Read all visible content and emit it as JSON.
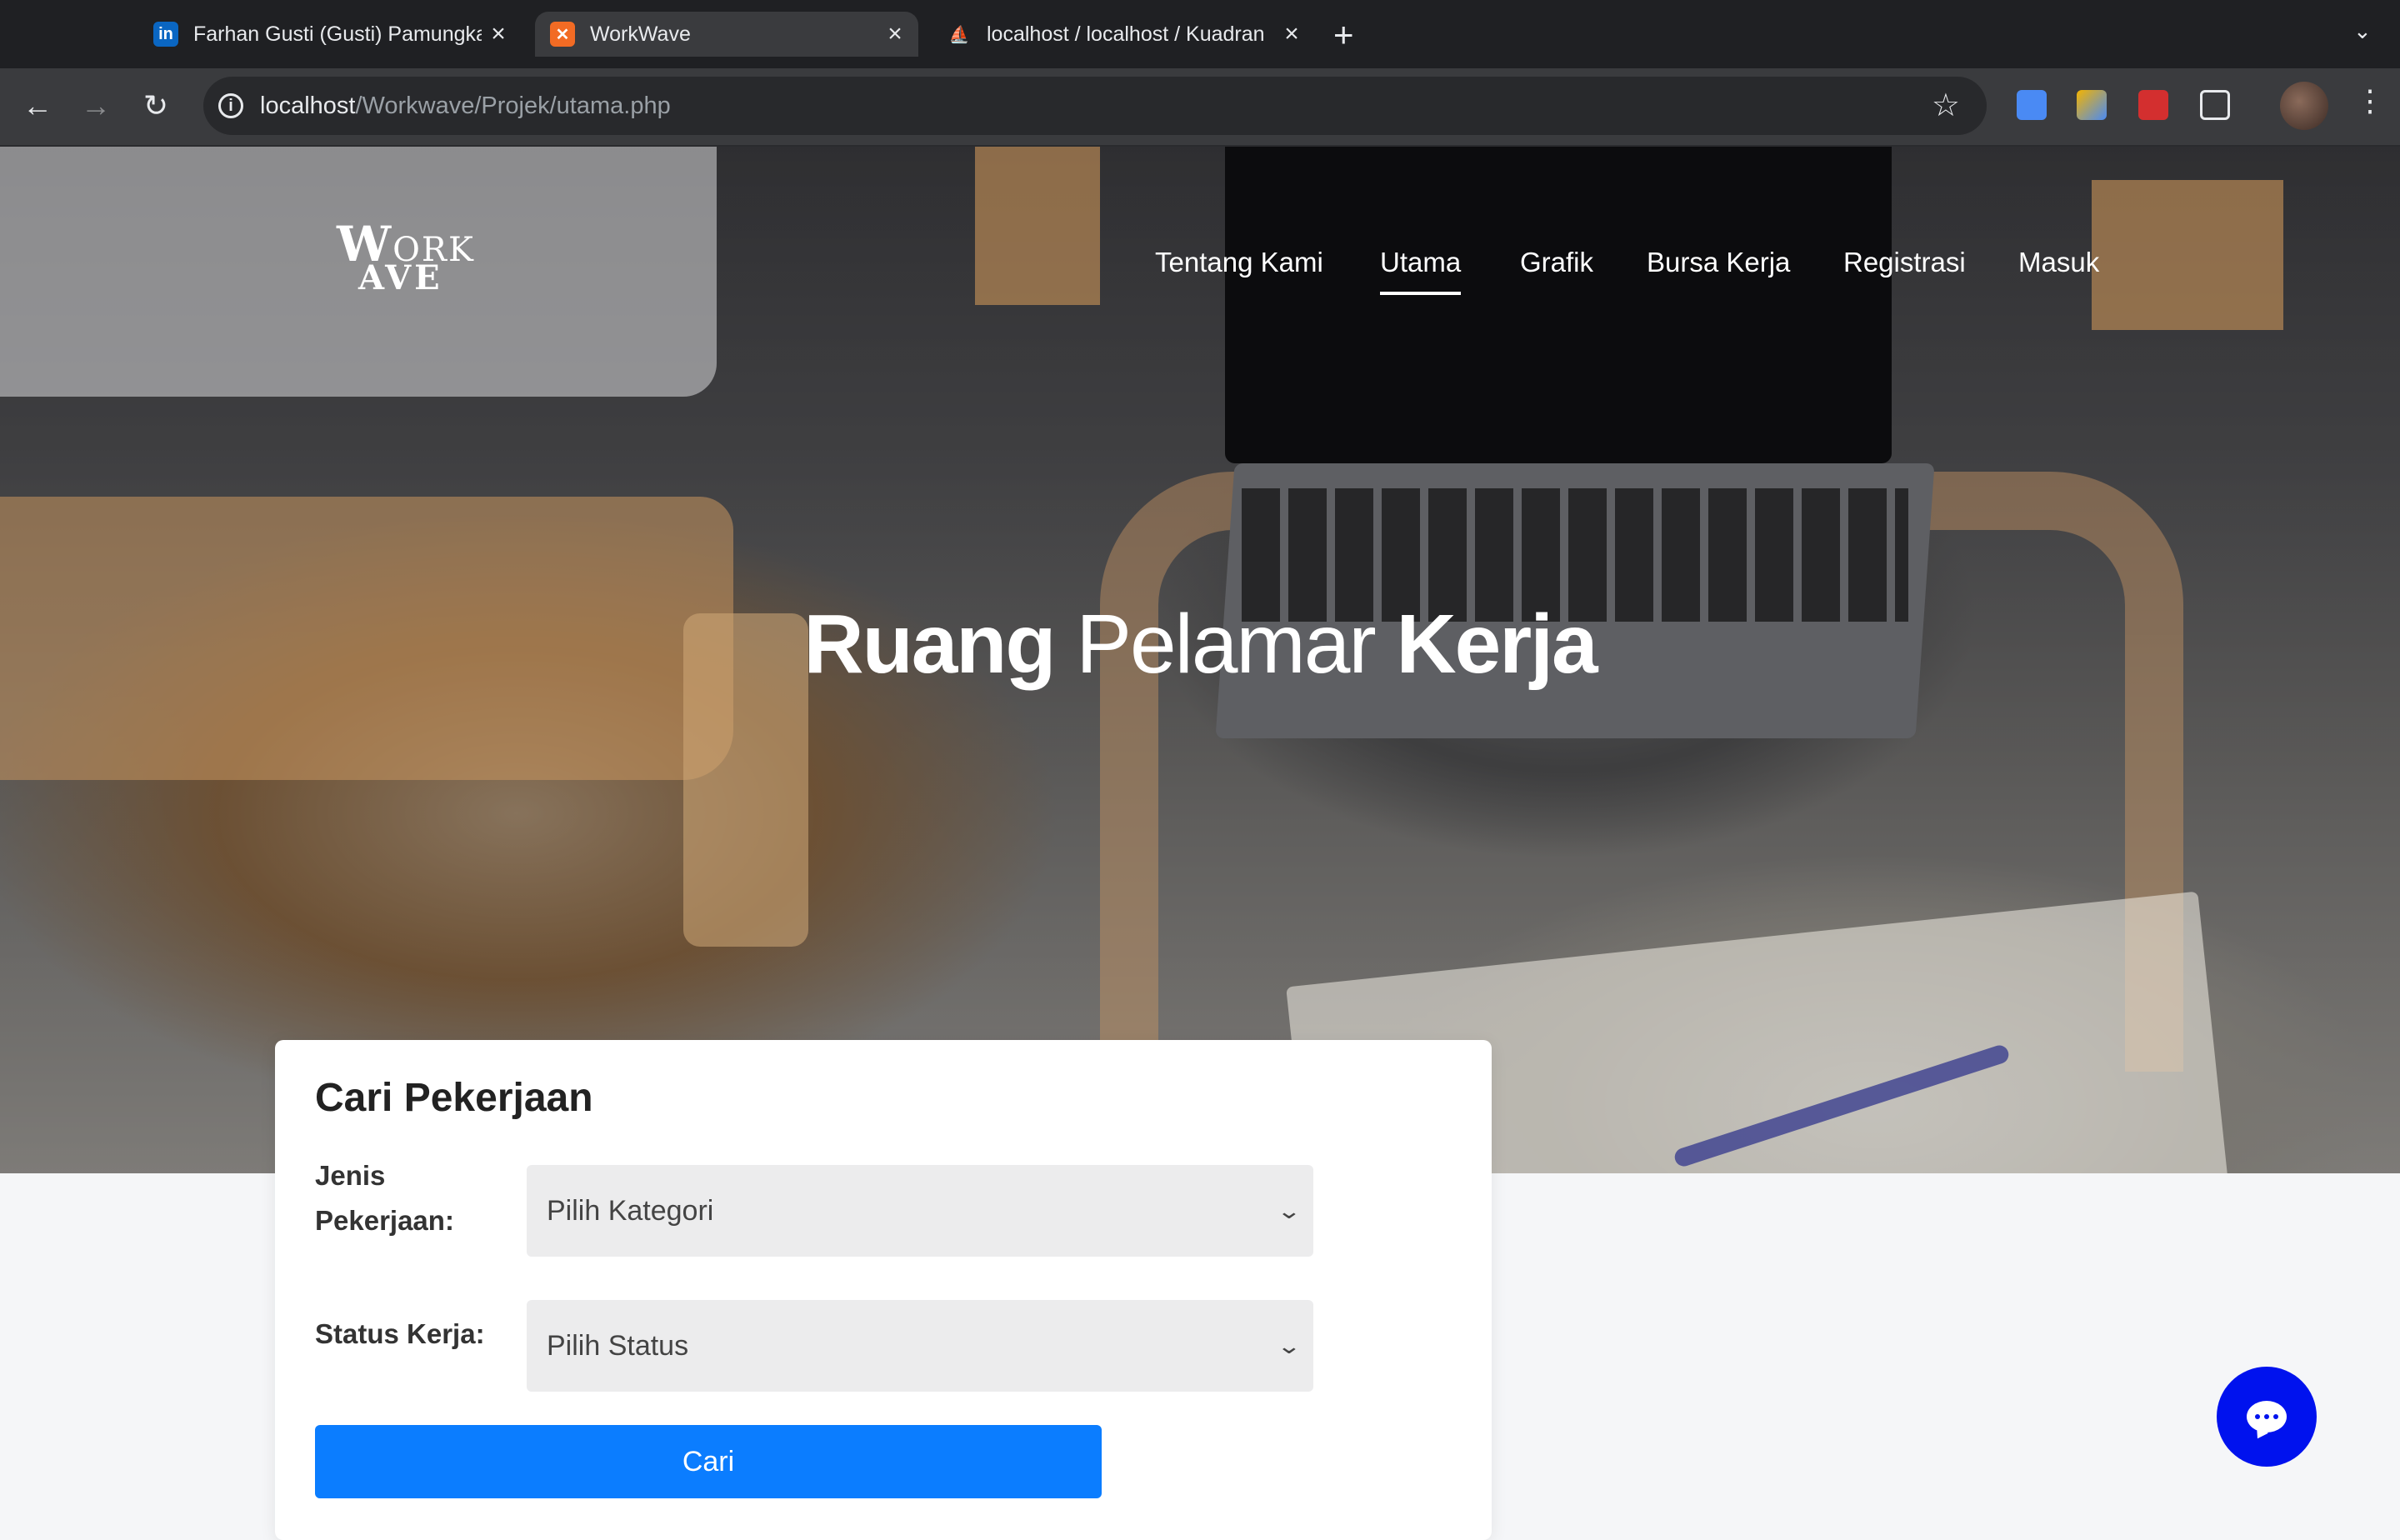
{
  "browser": {
    "tabs": [
      {
        "title": "Farhan Gusti (Gusti) Pamungkas",
        "icon": "linkedin-icon",
        "active": false
      },
      {
        "title": "WorkWave",
        "icon": "xampp-icon",
        "active": true
      },
      {
        "title": "localhost / localhost / Kuadran",
        "icon": "phpmyadmin-icon",
        "active": false
      }
    ],
    "url_host": "localhost",
    "url_path": "/Workwave/Projek/utama.php"
  },
  "site": {
    "logo_line1_big": "W",
    "logo_line1_small": "ORK",
    "logo_line2": "AVE",
    "nav": [
      {
        "label": "Tentang Kami",
        "active": false
      },
      {
        "label": "Utama",
        "active": true
      },
      {
        "label": "Grafik",
        "active": false
      },
      {
        "label": "Bursa Kerja",
        "active": false
      },
      {
        "label": "Registrasi",
        "active": false
      },
      {
        "label": "Masuk",
        "active": false
      }
    ],
    "hero": {
      "part1": "Ruang",
      "part2": "Pelamar",
      "part3": "Kerja"
    }
  },
  "search": {
    "title": "Cari Pekerjaan",
    "job_type_label_line1": "Jenis",
    "job_type_label_line2": "Pekerjaan:",
    "job_type_value": "Pilih Kategori",
    "status_label": "Status Kerja:",
    "status_value": "Pilih Status",
    "submit_label": "Cari"
  },
  "colors": {
    "primary_button": "#0b7dff",
    "chat_button": "#0012ee"
  }
}
